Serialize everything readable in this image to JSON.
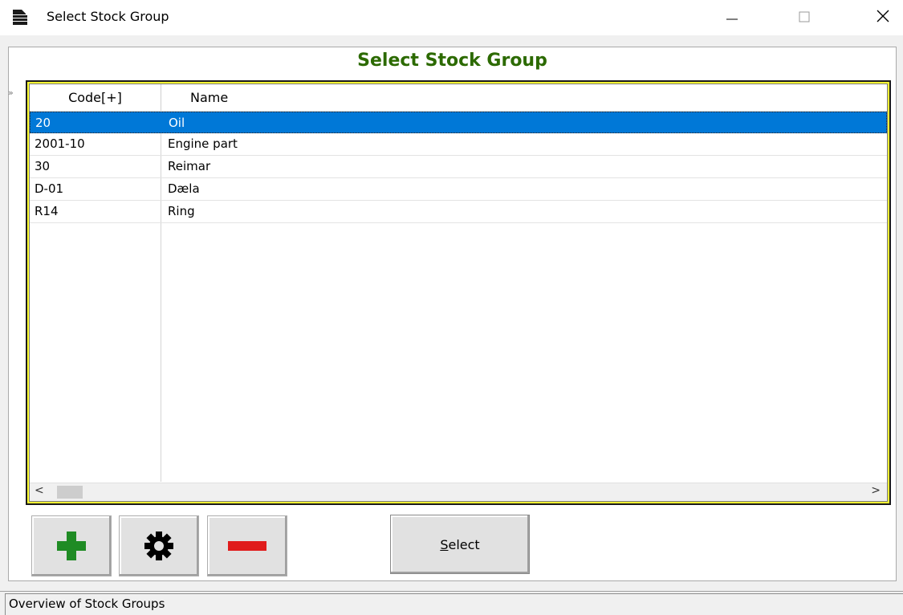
{
  "window": {
    "title": "Select Stock Group",
    "icon": "document-window-icon",
    "controls": [
      "minimize-icon",
      "maximize-icon",
      "close-icon"
    ]
  },
  "header": {
    "title": "Select Stock Group",
    "title_color": "#2c6a00"
  },
  "grid": {
    "columns": [
      "Code[+]",
      "Name"
    ],
    "rows": [
      {
        "code": "20",
        "name": "Oil",
        "selected": true
      },
      {
        "code": "2001-10",
        "name": "Engine part",
        "selected": false
      },
      {
        "code": "30",
        "name": "Reimar",
        "selected": false
      },
      {
        "code": "D-01",
        "name": "Dæla",
        "selected": false
      },
      {
        "code": "R14",
        "name": "Ring",
        "selected": false
      }
    ],
    "selection_color": "#0078d7",
    "frame_color": "#ffff33"
  },
  "toolbar": {
    "add_icon": "plus-icon",
    "settings_icon": "gear-icon",
    "remove_icon": "minus-icon",
    "select_label_underlined": "S",
    "select_label_rest": "elect"
  },
  "status": {
    "text": "Overview of Stock Groups"
  }
}
